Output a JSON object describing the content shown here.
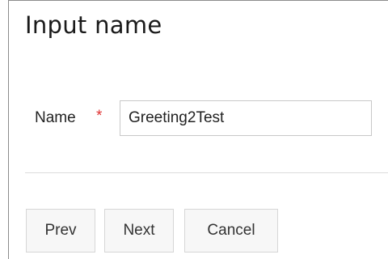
{
  "dialog": {
    "title": "Input name"
  },
  "form": {
    "name_label": "Name",
    "required_marker": "*",
    "name_value": "Greeting2Test"
  },
  "buttons": {
    "prev": "Prev",
    "next": "Next",
    "cancel": "Cancel"
  },
  "colors": {
    "required": "#e03333",
    "border": "#8c8c8c",
    "button_bg": "#f7f7f7"
  }
}
